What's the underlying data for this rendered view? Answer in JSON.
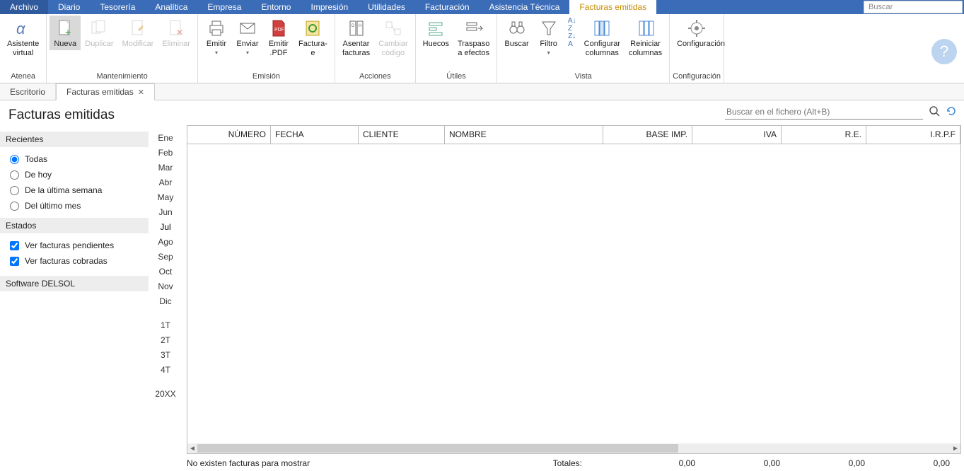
{
  "menubar": {
    "items": [
      "Archivo",
      "Diario",
      "Tesorería",
      "Analítica",
      "Empresa",
      "Entorno",
      "Impresión",
      "Utilidades",
      "Facturación",
      "Asistencia Técnica",
      "Facturas emitidas"
    ],
    "file_index": 0,
    "active_index": 10,
    "search_placeholder": "Buscar"
  },
  "ribbon": {
    "groups": [
      {
        "label": "Atenea",
        "items": [
          {
            "name": "asistente-virtual",
            "label": "Asistente\nvirtual",
            "disabled": false
          }
        ]
      },
      {
        "label": "Mantenimiento",
        "items": [
          {
            "name": "nueva",
            "label": "Nueva",
            "selected": true
          },
          {
            "name": "duplicar",
            "label": "Duplicar",
            "disabled": true
          },
          {
            "name": "modificar",
            "label": "Modificar",
            "disabled": true
          },
          {
            "name": "eliminar",
            "label": "Eliminar",
            "disabled": true
          }
        ]
      },
      {
        "label": "Emisión",
        "items": [
          {
            "name": "emitir",
            "label": "Emitir",
            "drop": true
          },
          {
            "name": "enviar",
            "label": "Enviar",
            "drop": true
          },
          {
            "name": "emitir-pdf",
            "label": "Emitir\n.PDF"
          },
          {
            "name": "factura-e",
            "label": "Factura-\ne"
          }
        ]
      },
      {
        "label": "Acciones",
        "items": [
          {
            "name": "asentar-facturas",
            "label": "Asentar\nfacturas"
          },
          {
            "name": "cambiar-codigo",
            "label": "Cambiar\ncódigo",
            "disabled": true
          }
        ]
      },
      {
        "label": "Útiles",
        "items": [
          {
            "name": "huecos",
            "label": "Huecos"
          },
          {
            "name": "traspaso-a-efectos",
            "label": "Traspaso\na efectos"
          }
        ]
      },
      {
        "label": "Vista",
        "items": [
          {
            "name": "buscar",
            "label": "Buscar"
          },
          {
            "name": "filtro",
            "label": "Filtro",
            "drop": true
          },
          {
            "name": "sort",
            "mini": true
          },
          {
            "name": "configurar-columnas",
            "label": "Configurar\ncolumnas"
          },
          {
            "name": "reiniciar-columnas",
            "label": "Reiniciar\ncolumnas"
          }
        ]
      },
      {
        "label": "Configuración",
        "items": [
          {
            "name": "configuracion",
            "label": "Configuración"
          }
        ]
      }
    ]
  },
  "subtabs": {
    "items": [
      {
        "label": "Escritorio",
        "closable": false
      },
      {
        "label": "Facturas emitidas",
        "closable": true,
        "active": true
      }
    ]
  },
  "page_title": "Facturas emitidas",
  "sidebar": {
    "recientes_header": "Recientes",
    "recientes": [
      {
        "label": "Todas",
        "type": "radio",
        "checked": true
      },
      {
        "label": "De hoy",
        "type": "radio",
        "checked": false
      },
      {
        "label": "De la última semana",
        "type": "radio",
        "checked": false
      },
      {
        "label": "Del último mes",
        "type": "radio",
        "checked": false
      }
    ],
    "estados_header": "Estados",
    "estados": [
      {
        "label": "Ver facturas pendientes",
        "type": "checkbox",
        "checked": true
      },
      {
        "label": "Ver facturas cobradas",
        "type": "checkbox",
        "checked": true
      }
    ],
    "footer": "Software DELSOL"
  },
  "months": [
    "Ene",
    "Feb",
    "Mar",
    "Abr",
    "May",
    "Jun",
    "Jul",
    "Ago",
    "Sep",
    "Oct",
    "Nov",
    "Dic",
    "",
    "1T",
    "2T",
    "3T",
    "4T",
    "",
    "20XX"
  ],
  "month_selected_index": 6,
  "content_search_placeholder": "Buscar en el fichero (Alt+B)",
  "grid": {
    "columns": [
      "NÚMERO",
      "FECHA",
      "CLIENTE",
      "NOMBRE",
      "BASE IMP.",
      "IVA",
      "R.E.",
      "I.R.P.F"
    ]
  },
  "status": {
    "message": "No existen facturas para mostrar",
    "totales_label": "Totales:",
    "vals": [
      "0,00",
      "0,00",
      "0,00",
      "0,00"
    ]
  }
}
